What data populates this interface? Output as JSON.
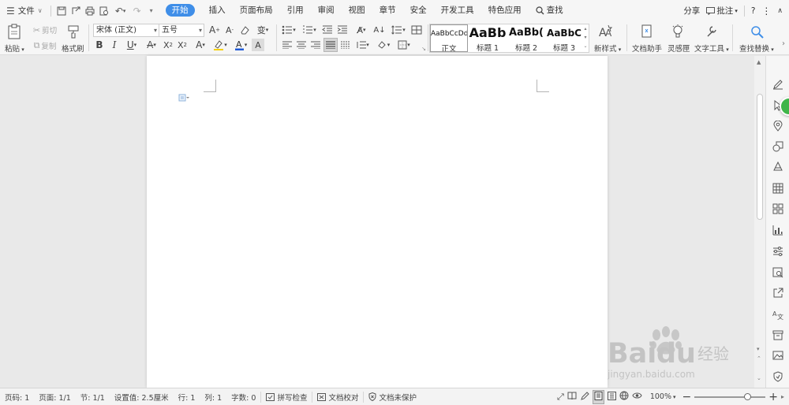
{
  "menubar": {
    "file_label": "文件",
    "tabs": [
      {
        "label": "开始",
        "active": true
      },
      {
        "label": "插入",
        "active": false
      },
      {
        "label": "页面布局",
        "active": false
      },
      {
        "label": "引用",
        "active": false
      },
      {
        "label": "审阅",
        "active": false
      },
      {
        "label": "视图",
        "active": false
      },
      {
        "label": "章节",
        "active": false
      },
      {
        "label": "安全",
        "active": false
      },
      {
        "label": "开发工具",
        "active": false
      },
      {
        "label": "特色应用",
        "active": false
      }
    ],
    "search_label": "查找",
    "share_label": "分享",
    "comment_label": "批注",
    "help_label": "?",
    "accent": "#3f8ee8"
  },
  "ribbon": {
    "paste": "粘贴",
    "cut": "剪切",
    "copy": "复制",
    "format_painter": "格式刷",
    "font_name": "宋体 (正文)",
    "font_size": "五号",
    "styles": [
      {
        "sample": "AaBbCcDd",
        "name": "正文"
      },
      {
        "sample": "AaBb",
        "name": "标题 1"
      },
      {
        "sample": "AaBb(",
        "name": "标题 2"
      },
      {
        "sample": "AaBbC",
        "name": "标题 3"
      }
    ],
    "new_style": "新样式",
    "doc_assistant": "文档助手",
    "inspiration": "灵感匣",
    "text_tools": "文字工具",
    "find_replace": "查找替换",
    "font_color": "#e02020",
    "highlight_color": "#f5d000",
    "char_color": "#1f5ad6"
  },
  "statusbar": {
    "page_num": "页码: 1",
    "pages": "页面: 1/1",
    "section": "节: 1/1",
    "setting": "设置值: 2.5厘米",
    "row": "行: 1",
    "col": "列: 1",
    "words": "字数: 0",
    "spell_check": "拼写检查",
    "doc_proof": "文档校对",
    "protect": "文档未保护",
    "zoom": "100%",
    "zoom_fraction": 0.75
  },
  "watermark": {
    "brand": "Bai",
    "brand_tail": "du",
    "suffix": "经验",
    "url": "jingyan.baidu.com"
  }
}
